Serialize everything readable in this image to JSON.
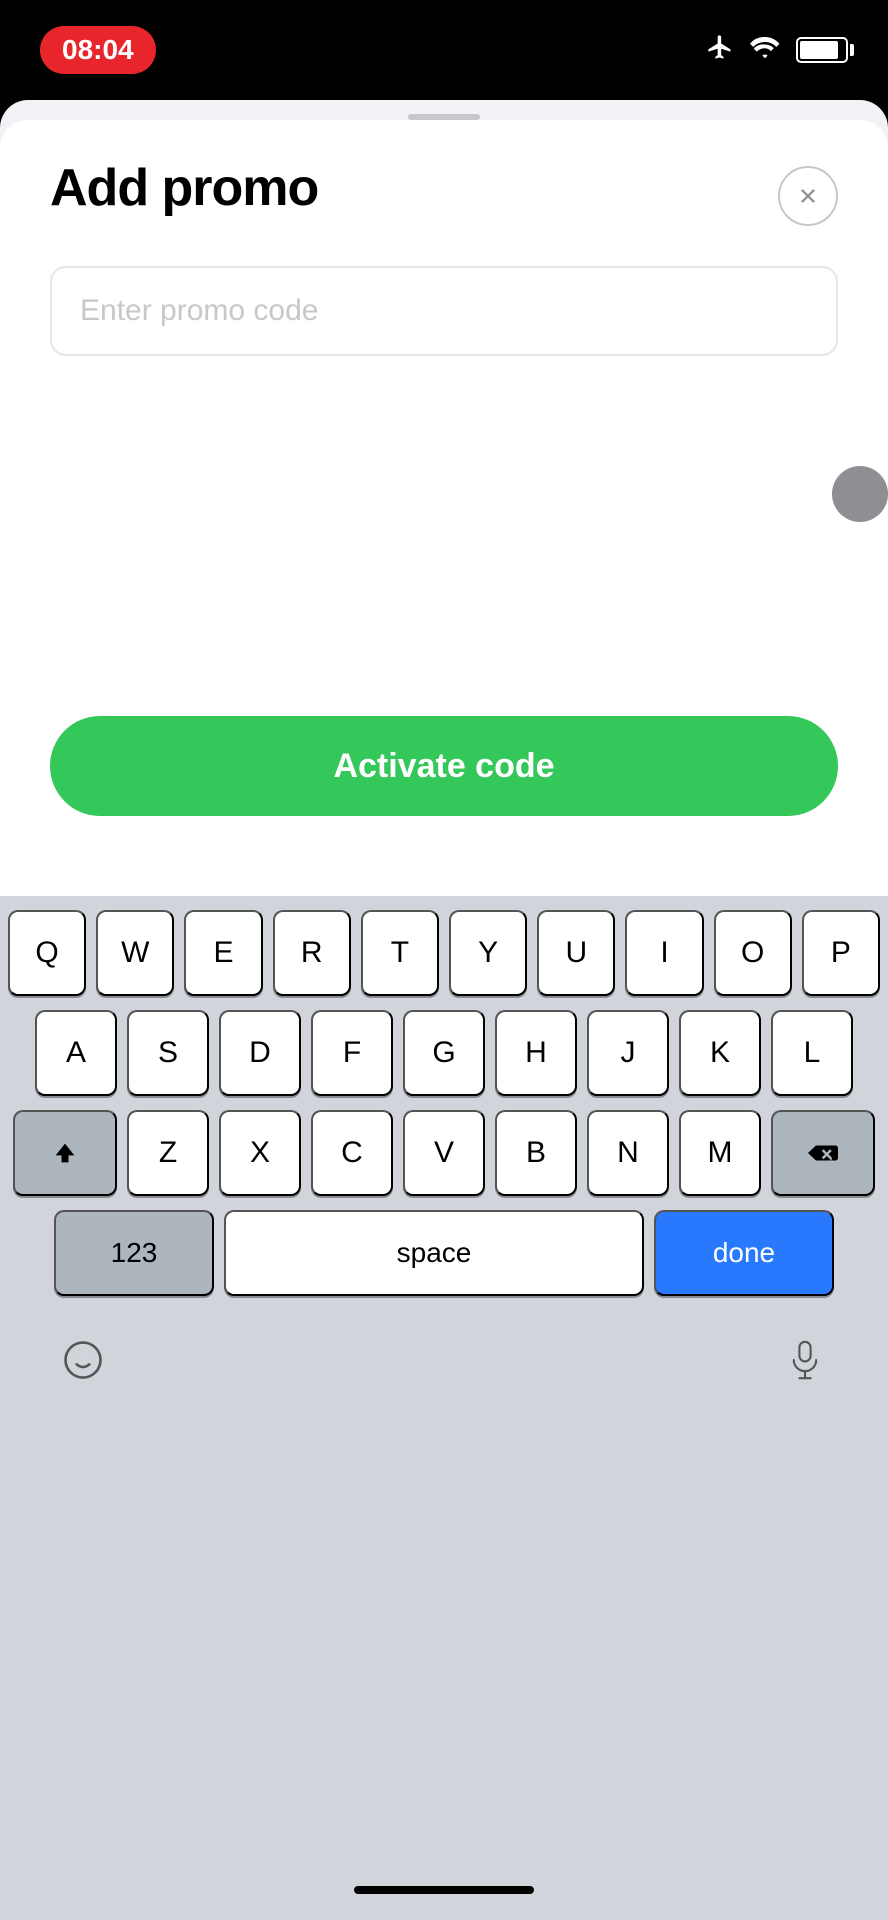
{
  "statusBar": {
    "time": "08:04"
  },
  "modal": {
    "title": "Add promo",
    "closeAriaLabel": "Close",
    "input": {
      "placeholder": "Enter promo code",
      "value": ""
    },
    "activateButton": "Activate code"
  },
  "keyboard": {
    "rows": [
      [
        "Q",
        "W",
        "E",
        "R",
        "T",
        "Y",
        "U",
        "I",
        "O",
        "P"
      ],
      [
        "A",
        "S",
        "D",
        "F",
        "G",
        "H",
        "J",
        "K",
        "L"
      ],
      [
        "Z",
        "X",
        "C",
        "V",
        "B",
        "N",
        "M"
      ]
    ],
    "numbersLabel": "123",
    "spaceLabel": "space",
    "doneLabel": "done"
  }
}
